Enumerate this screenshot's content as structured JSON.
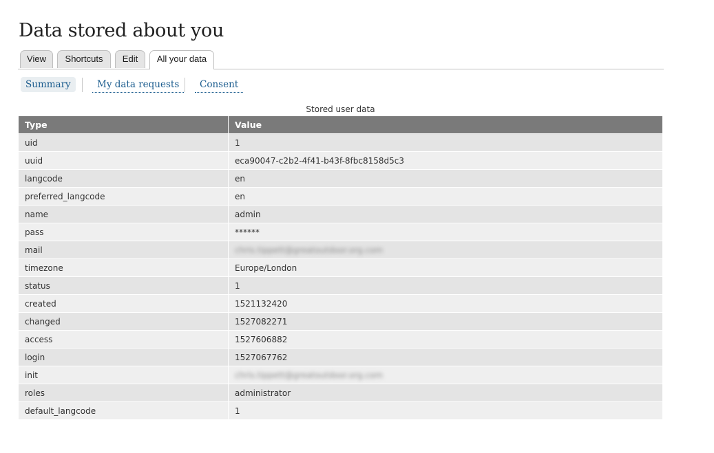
{
  "page": {
    "title": "Data stored about you"
  },
  "primary_tabs": [
    {
      "label": "View"
    },
    {
      "label": "Shortcuts"
    },
    {
      "label": "Edit"
    },
    {
      "label": "All your data"
    }
  ],
  "secondary_tabs": [
    {
      "label": "Summary"
    },
    {
      "label": "My data requests"
    },
    {
      "label": "Consent"
    }
  ],
  "table": {
    "caption": "Stored user data",
    "headers": {
      "type": "Type",
      "value": "Value"
    },
    "rows": [
      {
        "type": "uid",
        "value": "1"
      },
      {
        "type": "uuid",
        "value": "eca90047-c2b2-4f41-b43f-8fbc8158d5c3"
      },
      {
        "type": "langcode",
        "value": "en"
      },
      {
        "type": "preferred_langcode",
        "value": "en"
      },
      {
        "type": "name",
        "value": "admin"
      },
      {
        "type": "pass",
        "value": "******"
      },
      {
        "type": "mail",
        "value": "chris.tippett@greatoutdoor.org.com"
      },
      {
        "type": "timezone",
        "value": "Europe/London"
      },
      {
        "type": "status",
        "value": "1"
      },
      {
        "type": "created",
        "value": "1521132420"
      },
      {
        "type": "changed",
        "value": "1527082271"
      },
      {
        "type": "access",
        "value": "1527606882"
      },
      {
        "type": "login",
        "value": "1527067762"
      },
      {
        "type": "init",
        "value": "chris.tippett@greatoutdoor.org.com"
      },
      {
        "type": "roles",
        "value": "administrator"
      },
      {
        "type": "default_langcode",
        "value": "1"
      }
    ]
  },
  "colors": {
    "link": "#1b5c8e",
    "header_bg": "#7a7a7a",
    "row_odd": "#e4e4e4",
    "row_even": "#efefef"
  }
}
